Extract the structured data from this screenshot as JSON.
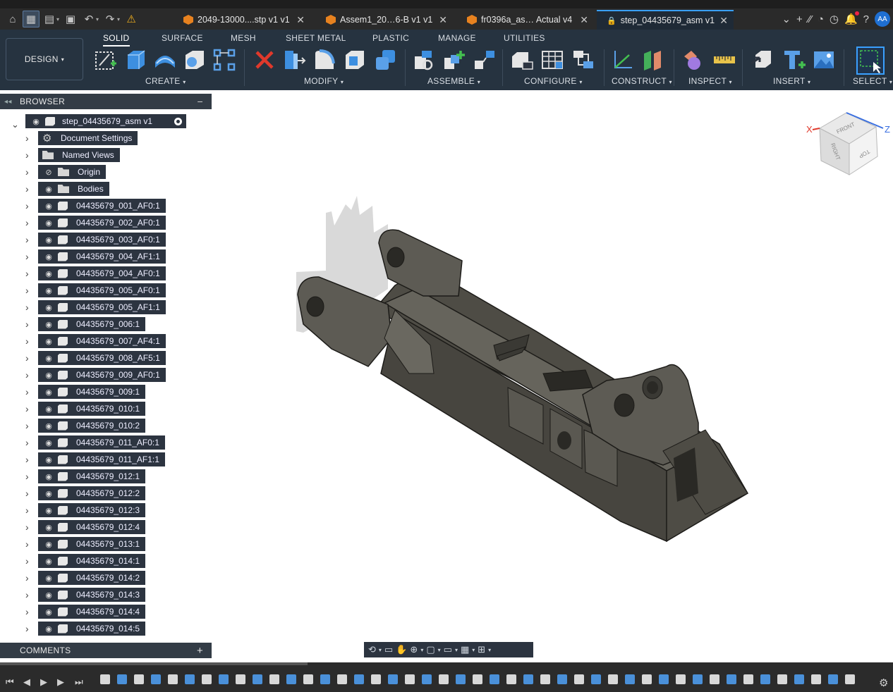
{
  "tabs": [
    {
      "label": "2049-13000....stp v1 v1",
      "active": false
    },
    {
      "label": "Assem1_20…6-B v1 v1",
      "active": false
    },
    {
      "label": "fr0396a_as… Actual v4",
      "active": false
    },
    {
      "label": "step_04435679_asm v1",
      "active": true
    }
  ],
  "user_initials": "AA",
  "workspace": "DESIGN",
  "ribbon_tabs": [
    "SOLID",
    "SURFACE",
    "MESH",
    "SHEET METAL",
    "PLASTIC",
    "MANAGE",
    "UTILITIES"
  ],
  "groups": {
    "create": "CREATE",
    "modify": "MODIFY",
    "assemble": "ASSEMBLE",
    "configure": "CONFIGURE",
    "construct": "CONSTRUCT",
    "inspect": "INSPECT",
    "insert": "INSERT",
    "select": "SELECT"
  },
  "browser": {
    "title": "BROWSER",
    "root": "step_04435679_asm v1",
    "folders": [
      {
        "label": "Document Settings",
        "icon": "gear-icon"
      },
      {
        "label": "Named Views",
        "icon": "folder-icon"
      },
      {
        "label": "Origin",
        "icon": "folder-icon",
        "hidden": true
      },
      {
        "label": "Bodies",
        "icon": "folder-icon"
      }
    ],
    "components": [
      "04435679_001_AF0:1",
      "04435679_002_AF0:1",
      "04435679_003_AF0:1",
      "04435679_004_AF1:1",
      "04435679_004_AF0:1",
      "04435679_005_AF0:1",
      "04435679_005_AF1:1",
      "04435679_006:1",
      "04435679_007_AF4:1",
      "04435679_008_AF5:1",
      "04435679_009_AF0:1",
      "04435679_009:1",
      "04435679_010:1",
      "04435679_010:2",
      "04435679_011_AF0:1",
      "04435679_011_AF1:1",
      "04435679_012:1",
      "04435679_012:2",
      "04435679_012:3",
      "04435679_012:4",
      "04435679_013:1",
      "04435679_014:1",
      "04435679_014:2",
      "04435679_014:3",
      "04435679_014:4",
      "04435679_014:5"
    ]
  },
  "comments_label": "COMMENTS",
  "viewcube": {
    "front": "FRONT",
    "right": "RIGHT",
    "top": "TOP",
    "x": "X",
    "z": "Z"
  },
  "accent_color": "#3aa0ff"
}
